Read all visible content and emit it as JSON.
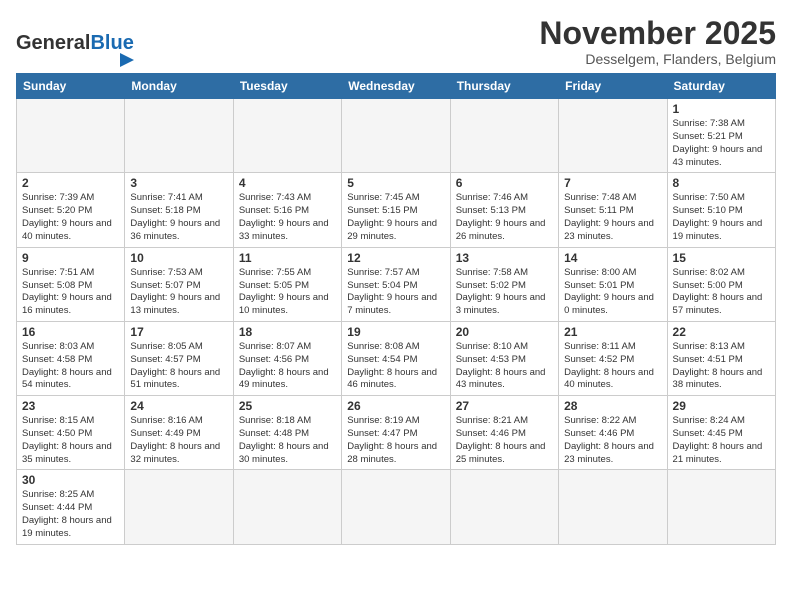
{
  "header": {
    "logo_general": "General",
    "logo_blue": "Blue",
    "title": "November 2025",
    "subtitle": "Desselgem, Flanders, Belgium"
  },
  "weekdays": [
    "Sunday",
    "Monday",
    "Tuesday",
    "Wednesday",
    "Thursday",
    "Friday",
    "Saturday"
  ],
  "days": [
    {
      "date": "",
      "info": "",
      "empty": true
    },
    {
      "date": "",
      "info": "",
      "empty": true
    },
    {
      "date": "",
      "info": "",
      "empty": true
    },
    {
      "date": "",
      "info": "",
      "empty": true
    },
    {
      "date": "",
      "info": "",
      "empty": true
    },
    {
      "date": "",
      "info": "",
      "empty": true
    },
    {
      "date": "1",
      "info": "Sunrise: 7:38 AM\nSunset: 5:21 PM\nDaylight: 9 hours and 43 minutes."
    },
    {
      "date": "2",
      "info": "Sunrise: 7:39 AM\nSunset: 5:20 PM\nDaylight: 9 hours and 40 minutes."
    },
    {
      "date": "3",
      "info": "Sunrise: 7:41 AM\nSunset: 5:18 PM\nDaylight: 9 hours and 36 minutes."
    },
    {
      "date": "4",
      "info": "Sunrise: 7:43 AM\nSunset: 5:16 PM\nDaylight: 9 hours and 33 minutes."
    },
    {
      "date": "5",
      "info": "Sunrise: 7:45 AM\nSunset: 5:15 PM\nDaylight: 9 hours and 29 minutes."
    },
    {
      "date": "6",
      "info": "Sunrise: 7:46 AM\nSunset: 5:13 PM\nDaylight: 9 hours and 26 minutes."
    },
    {
      "date": "7",
      "info": "Sunrise: 7:48 AM\nSunset: 5:11 PM\nDaylight: 9 hours and 23 minutes."
    },
    {
      "date": "8",
      "info": "Sunrise: 7:50 AM\nSunset: 5:10 PM\nDaylight: 9 hours and 19 minutes."
    },
    {
      "date": "9",
      "info": "Sunrise: 7:51 AM\nSunset: 5:08 PM\nDaylight: 9 hours and 16 minutes."
    },
    {
      "date": "10",
      "info": "Sunrise: 7:53 AM\nSunset: 5:07 PM\nDaylight: 9 hours and 13 minutes."
    },
    {
      "date": "11",
      "info": "Sunrise: 7:55 AM\nSunset: 5:05 PM\nDaylight: 9 hours and 10 minutes."
    },
    {
      "date": "12",
      "info": "Sunrise: 7:57 AM\nSunset: 5:04 PM\nDaylight: 9 hours and 7 minutes."
    },
    {
      "date": "13",
      "info": "Sunrise: 7:58 AM\nSunset: 5:02 PM\nDaylight: 9 hours and 3 minutes."
    },
    {
      "date": "14",
      "info": "Sunrise: 8:00 AM\nSunset: 5:01 PM\nDaylight: 9 hours and 0 minutes."
    },
    {
      "date": "15",
      "info": "Sunrise: 8:02 AM\nSunset: 5:00 PM\nDaylight: 8 hours and 57 minutes."
    },
    {
      "date": "16",
      "info": "Sunrise: 8:03 AM\nSunset: 4:58 PM\nDaylight: 8 hours and 54 minutes."
    },
    {
      "date": "17",
      "info": "Sunrise: 8:05 AM\nSunset: 4:57 PM\nDaylight: 8 hours and 51 minutes."
    },
    {
      "date": "18",
      "info": "Sunrise: 8:07 AM\nSunset: 4:56 PM\nDaylight: 8 hours and 49 minutes."
    },
    {
      "date": "19",
      "info": "Sunrise: 8:08 AM\nSunset: 4:54 PM\nDaylight: 8 hours and 46 minutes."
    },
    {
      "date": "20",
      "info": "Sunrise: 8:10 AM\nSunset: 4:53 PM\nDaylight: 8 hours and 43 minutes."
    },
    {
      "date": "21",
      "info": "Sunrise: 8:11 AM\nSunset: 4:52 PM\nDaylight: 8 hours and 40 minutes."
    },
    {
      "date": "22",
      "info": "Sunrise: 8:13 AM\nSunset: 4:51 PM\nDaylight: 8 hours and 38 minutes."
    },
    {
      "date": "23",
      "info": "Sunrise: 8:15 AM\nSunset: 4:50 PM\nDaylight: 8 hours and 35 minutes."
    },
    {
      "date": "24",
      "info": "Sunrise: 8:16 AM\nSunset: 4:49 PM\nDaylight: 8 hours and 32 minutes."
    },
    {
      "date": "25",
      "info": "Sunrise: 8:18 AM\nSunset: 4:48 PM\nDaylight: 8 hours and 30 minutes."
    },
    {
      "date": "26",
      "info": "Sunrise: 8:19 AM\nSunset: 4:47 PM\nDaylight: 8 hours and 28 minutes."
    },
    {
      "date": "27",
      "info": "Sunrise: 8:21 AM\nSunset: 4:46 PM\nDaylight: 8 hours and 25 minutes."
    },
    {
      "date": "28",
      "info": "Sunrise: 8:22 AM\nSunset: 4:46 PM\nDaylight: 8 hours and 23 minutes."
    },
    {
      "date": "29",
      "info": "Sunrise: 8:24 AM\nSunset: 4:45 PM\nDaylight: 8 hours and 21 minutes."
    },
    {
      "date": "30",
      "info": "Sunrise: 8:25 AM\nSunset: 4:44 PM\nDaylight: 8 hours and 19 minutes."
    }
  ]
}
